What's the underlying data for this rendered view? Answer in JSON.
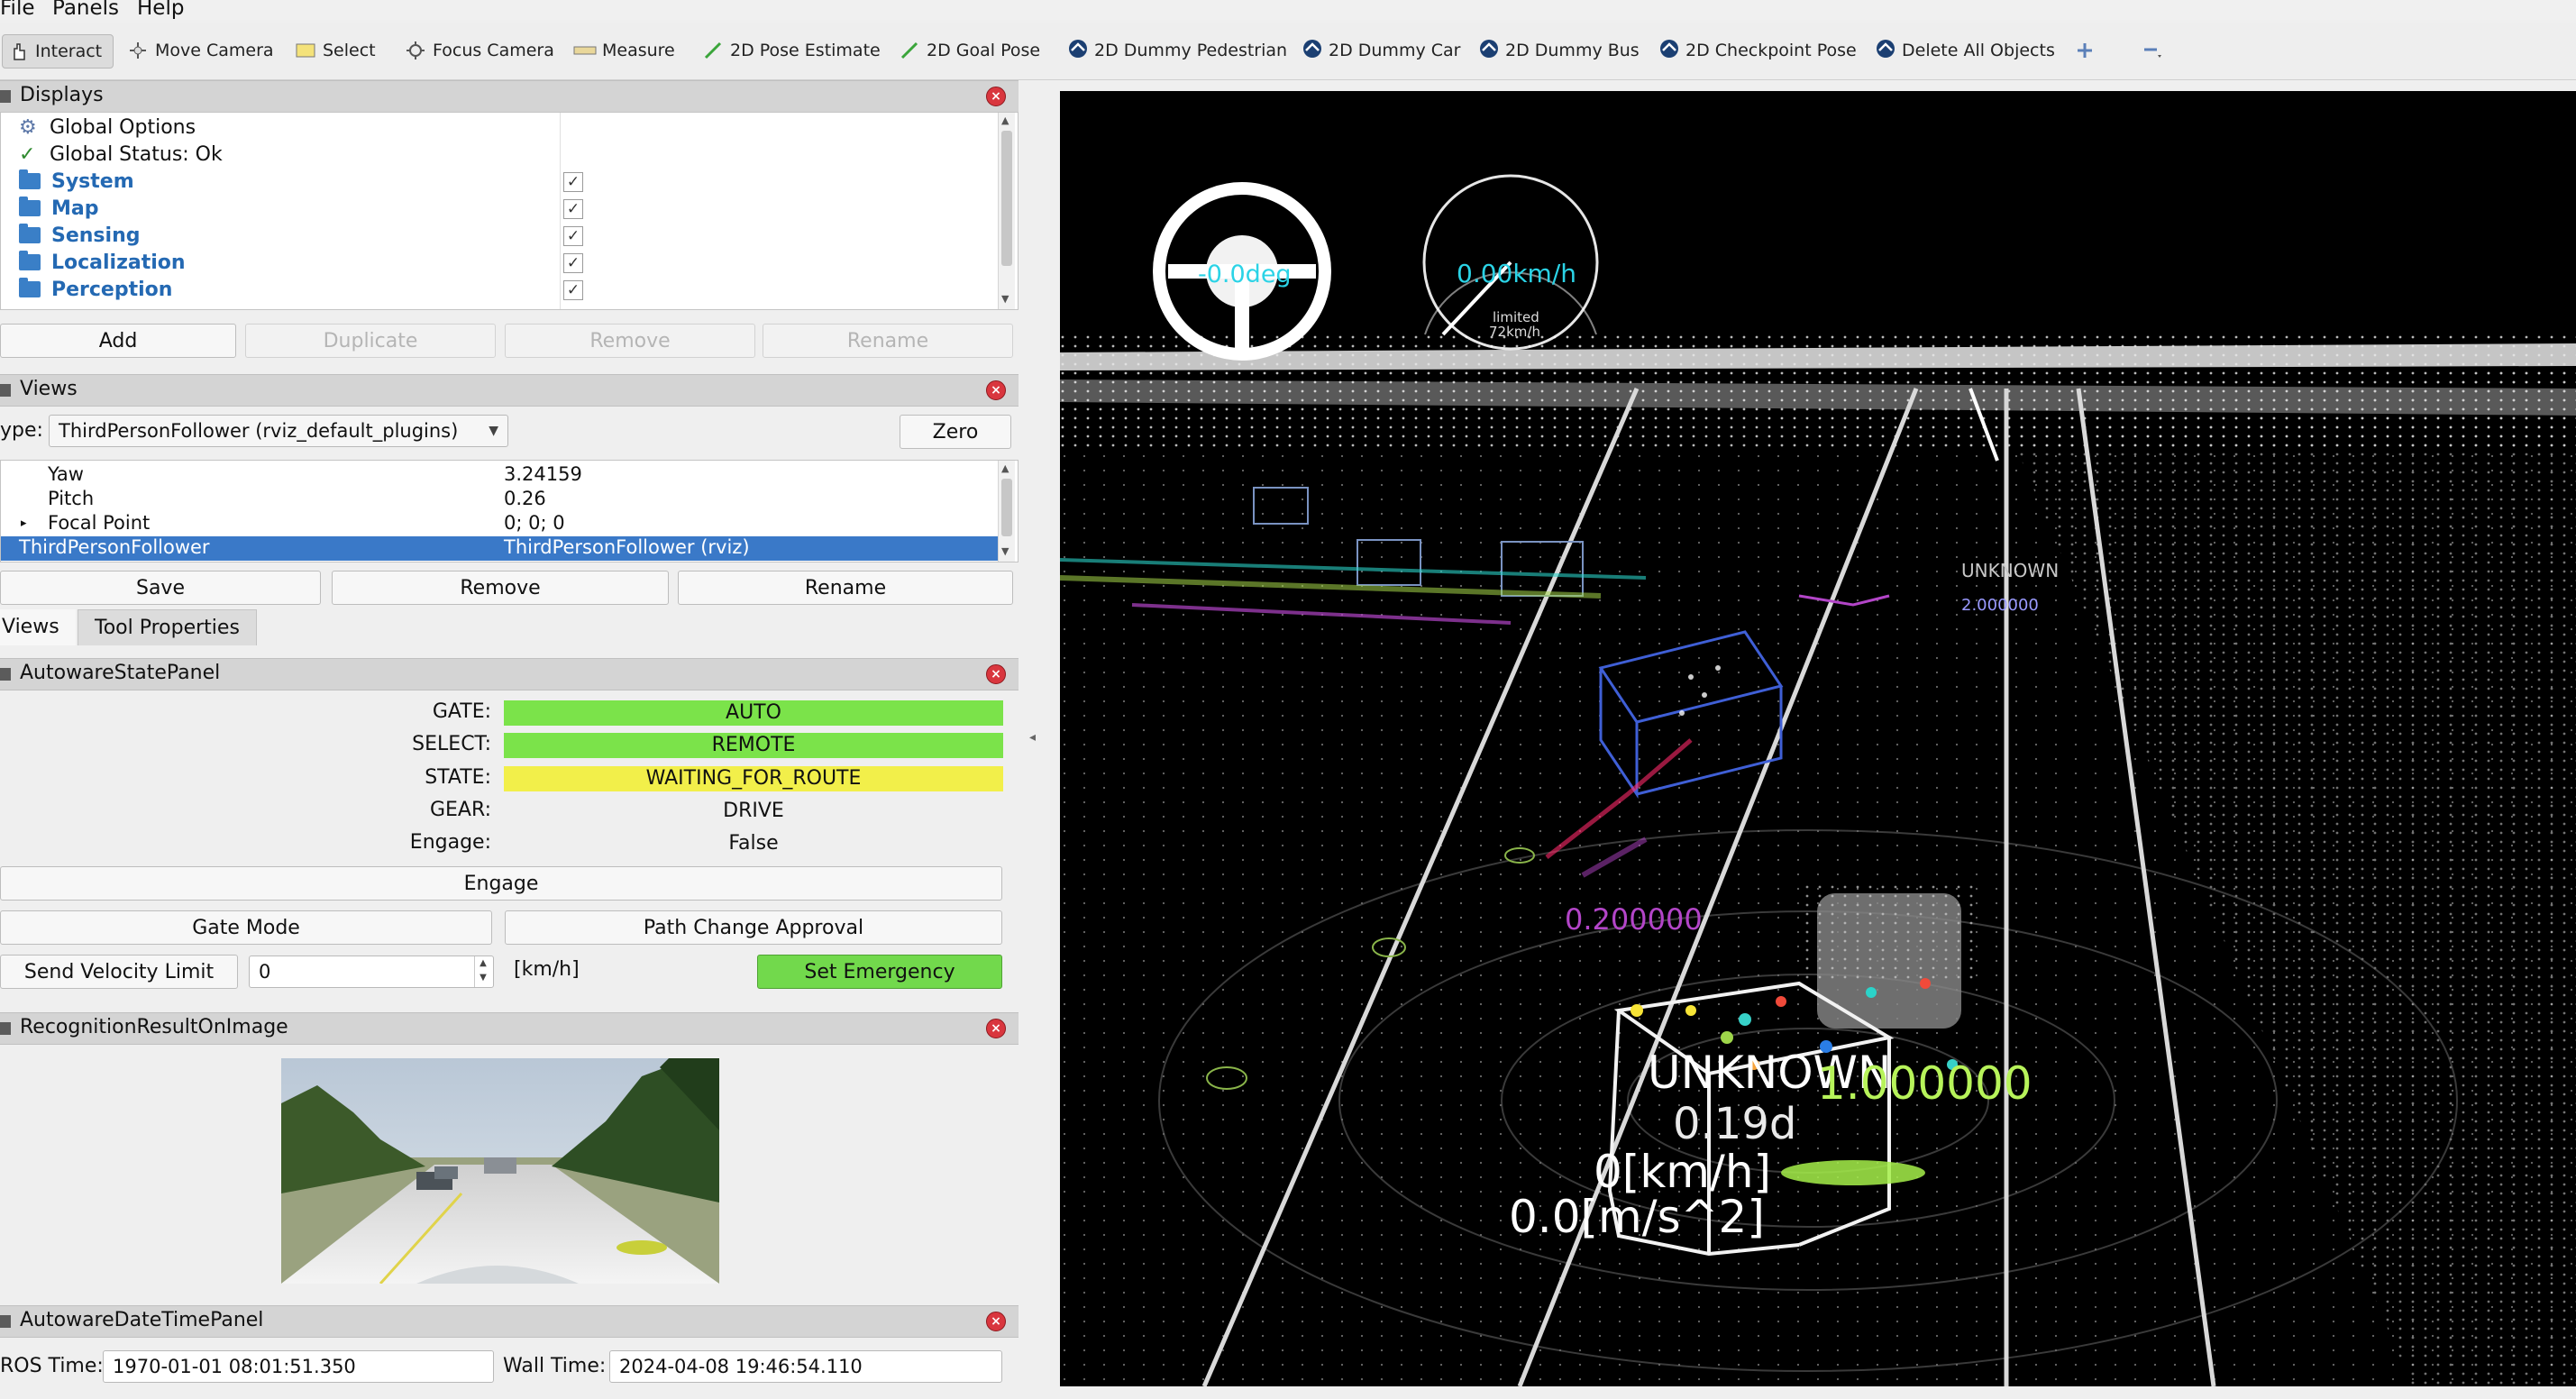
{
  "menubar": {
    "items": [
      "File",
      "Panels",
      "Help"
    ]
  },
  "toolbar": {
    "tools": [
      {
        "label": "Interact",
        "icon": "interact-icon"
      },
      {
        "label": "Move Camera",
        "icon": "move-camera-icon"
      },
      {
        "label": "Select",
        "icon": "select-icon"
      },
      {
        "label": "Focus Camera",
        "icon": "focus-camera-icon"
      },
      {
        "label": "Measure",
        "icon": "measure-icon"
      },
      {
        "label": "2D Pose Estimate",
        "icon": "pose-estimate-icon"
      },
      {
        "label": "2D Goal Pose",
        "icon": "goal-pose-icon"
      },
      {
        "label": "2D Dummy Pedestrian",
        "icon": "autoware-icon"
      },
      {
        "label": "2D Dummy Car",
        "icon": "autoware-icon"
      },
      {
        "label": "2D Dummy Bus",
        "icon": "autoware-icon"
      },
      {
        "label": "2D Checkpoint Pose",
        "icon": "autoware-icon"
      },
      {
        "label": "Delete All Objects",
        "icon": "autoware-icon"
      }
    ]
  },
  "displays": {
    "title": "Displays",
    "items": [
      {
        "label": "Global Options",
        "style": "plain",
        "icon": "gear-icon"
      },
      {
        "label": "Global Status: Ok",
        "style": "plain",
        "icon": "check-icon"
      },
      {
        "label": "System",
        "style": "group",
        "checked": "✓"
      },
      {
        "label": "Map",
        "style": "group",
        "checked": "✓"
      },
      {
        "label": "Sensing",
        "style": "group",
        "checked": "✓"
      },
      {
        "label": "Localization",
        "style": "group",
        "checked": "✓"
      },
      {
        "label": "Perception",
        "style": "group",
        "checked": "✓"
      }
    ],
    "buttons": {
      "add": "Add",
      "duplicate": "Duplicate",
      "remove": "Remove",
      "rename": "Rename"
    }
  },
  "views": {
    "title": "Views",
    "type_label": "ype:",
    "type_value": "ThirdPersonFollower (rviz_default_plugins)",
    "zero": "Zero",
    "props": [
      {
        "name": "Yaw",
        "value": "3.24159"
      },
      {
        "name": "Pitch",
        "value": "0.26"
      },
      {
        "name": "Focal Point",
        "value": "0; 0; 0"
      },
      {
        "name": "ThirdPersonFollower",
        "value": "ThirdPersonFollower (rviz)"
      }
    ],
    "buttons": {
      "save": "Save",
      "remove": "Remove",
      "rename": "Rename"
    },
    "tabs": [
      "Views",
      "Tool Properties"
    ]
  },
  "state_panel": {
    "title": "AutowareStatePanel",
    "rows": [
      {
        "label": "GATE:",
        "value": "AUTO",
        "color": "#7be34a"
      },
      {
        "label": "SELECT:",
        "value": "REMOTE",
        "color": "#7be34a"
      },
      {
        "label": "STATE:",
        "value": "WAITING_FOR_ROUTE",
        "color": "#f2ef4a"
      },
      {
        "label": "GEAR:",
        "value": "DRIVE",
        "color": ""
      },
      {
        "label": "Engage:",
        "value": "False",
        "color": ""
      }
    ],
    "engage": "Engage",
    "gate_mode": "Gate Mode",
    "path_change": "Path Change Approval",
    "send_velocity": "Send Velocity Limit",
    "velocity_value": "0",
    "unit": "[km/h]",
    "set_emergency": "Set Emergency"
  },
  "recognition": {
    "title": "RecognitionResultOnImage"
  },
  "datetime": {
    "title": "AutowareDateTimePanel",
    "ros_label": "ROS Time:",
    "ros_value": "1970-01-01 08:01:51.350",
    "wall_label": "Wall Time:",
    "wall_value": "2024-04-08 19:46:54.110"
  },
  "viewport": {
    "steering": "-0.0deg",
    "speed": "0.00km/h",
    "limit_line1": "limited",
    "limit_line2": "72km/h",
    "obj_class": "UNKNOWN",
    "obj_score": "1.000000",
    "obj_yaw": "0.19d",
    "obj_speed": "0[km/h]",
    "obj_accel": "0.0[m/s^2]",
    "small_score": "0.200000",
    "label_far": "UNKNOWN",
    "label_mid": "2.000000"
  }
}
